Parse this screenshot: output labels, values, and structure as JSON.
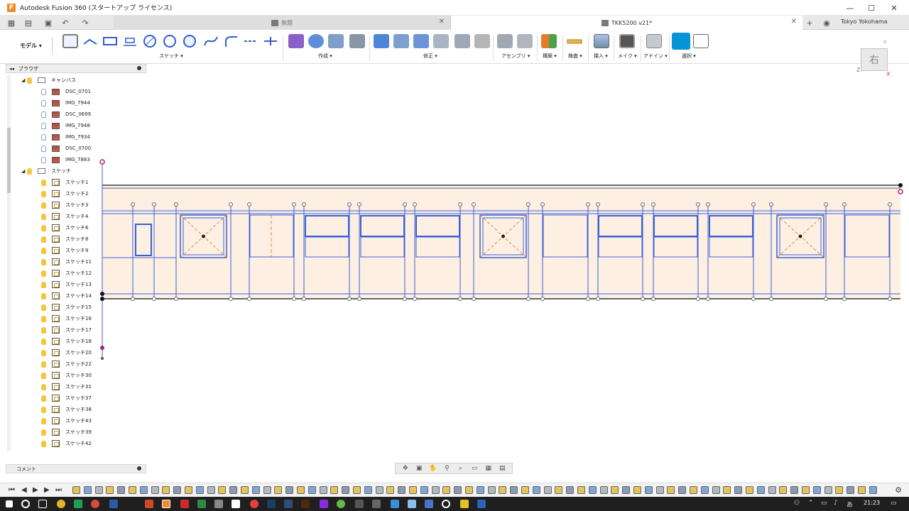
{
  "window": {
    "app_icon": "F",
    "title": "Autodesk Fusion 360 (スタートアップ ライセンス)",
    "minimize_icon": "minimize-icon",
    "maximize_icon": "maximize-icon",
    "close_icon": "close-icon"
  },
  "tabs": [
    {
      "label": "無題",
      "active": false
    },
    {
      "label": "TKK5200 v21*",
      "active": true
    }
  ],
  "user": {
    "name": "Tokyo Yokohama"
  },
  "toolbar": {
    "workspace": "モデル",
    "groups": [
      {
        "label": "スケッチ ▾"
      },
      {
        "label": "作成 ▾"
      },
      {
        "label": "修正 ▾"
      },
      {
        "label": "アセンブリ ▾"
      },
      {
        "label": "構築 ▾"
      },
      {
        "label": "検査 ▾"
      },
      {
        "label": "挿入 ▾"
      },
      {
        "label": "メイク ▾"
      },
      {
        "label": "アドイン ▾"
      },
      {
        "label": "選択 ▾"
      }
    ]
  },
  "viewcube": {
    "face": "右",
    "axis_z": "Z",
    "axis_x": "X",
    "axis_y": "Y"
  },
  "browser": {
    "title": "ブラウザ",
    "collapse_icon": "◂◂",
    "canvas_folder": "キャンバス",
    "canvases": [
      "DSC_0701",
      "IMG_7944",
      "DSC_0699",
      "IMG_7948",
      "IMG_7934",
      "DSC_0700",
      "IMG_7883"
    ],
    "sketch_folder": "スケッチ",
    "sketches": [
      "スケッチ1",
      "スケッチ2",
      "スケッチ3",
      "スケッチ4",
      "スケッチ6",
      "スケッチ8",
      "スケッチ9",
      "スケッチ11",
      "スケッチ12",
      "スケッチ13",
      "スケッチ14",
      "スケッチ15",
      "スケッチ16",
      "スケッチ17",
      "スケッチ18",
      "スケッチ20",
      "スケッチ22",
      "スケッチ30",
      "スケッチ31",
      "スケッチ37",
      "スケッチ38",
      "スケッチ43",
      "スケッチ39",
      "スケッチ42"
    ]
  },
  "comment": {
    "label": "コメント"
  },
  "taskbar": {
    "time": "21:23"
  },
  "colors": {
    "sketch_line": "#3a5fd9",
    "construction": "#e08a3c",
    "canvas_fill": "#fdf0e2",
    "accent": "#0696d7"
  }
}
